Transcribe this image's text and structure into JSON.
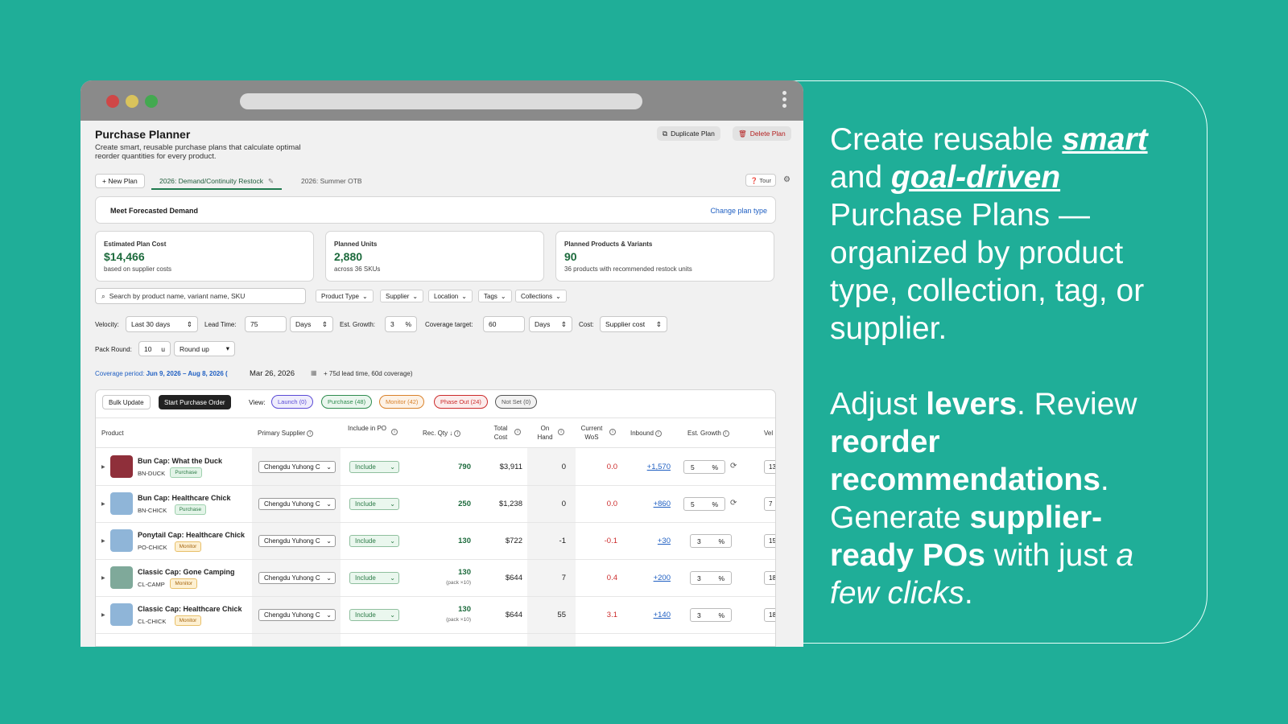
{
  "callout": {
    "p1": [
      "Create reusable ",
      "smart",
      " and ",
      "goal-driven",
      " Purchase Plans — organized by product type, collection, tag, or supplier."
    ],
    "p2": [
      "Adjust ",
      "levers",
      ". Review ",
      "reorder recommendations",
      ". Generate ",
      "supplier-ready POs",
      " with just ",
      "a few clicks",
      "."
    ]
  },
  "header": {
    "title": "Purchase Planner",
    "subtitle": "Create smart, reusable purchase plans that calculate optimal reorder quantities for every product.",
    "duplicate_label": "Duplicate Plan",
    "delete_label": "Delete Plan"
  },
  "tabs": {
    "new_label": "+ New Plan",
    "active": "2026: Demand/Continuity Restock",
    "inactive": "2026: Summer OTB",
    "tour": "Tour"
  },
  "plan_type": {
    "label": "Meet Forecasted Demand",
    "change_link": "Change plan type"
  },
  "stats": [
    {
      "label": "Estimated Plan Cost",
      "value": "$14,466",
      "sub": "based on supplier costs"
    },
    {
      "label": "Planned Units",
      "value": "2,880",
      "sub": "across 36 SKUs"
    },
    {
      "label": "Planned Products & Variants",
      "value": "90",
      "sub": "36 products with recommended restock units"
    }
  ],
  "search": {
    "placeholder": "Search by product name, variant name, SKU"
  },
  "filters": [
    "Product Type",
    "Supplier",
    "Location",
    "Tags",
    "Collections"
  ],
  "controls": {
    "velocity_label": "Velocity:",
    "velocity_value": "Last 30 days",
    "lead_label": "Lead Time:",
    "lead_value": "75",
    "lead_unit": "Days",
    "growth_label": "Est. Growth:",
    "growth_value": "3",
    "growth_unit": "%",
    "coverage_label": "Coverage target:",
    "coverage_value": "60",
    "coverage_unit": "Days",
    "cost_label": "Cost:",
    "cost_value": "Supplier cost",
    "pack_label": "Pack Round:",
    "pack_value": "10",
    "pack_unit": "u",
    "round_value": "Round up"
  },
  "coverage": {
    "prefix": "Coverage period: ",
    "range": "Jun 9, 2026 – Aug 8, 2026 (",
    "date": "Mar 26, 2026",
    "note": "+ 75d lead time, 60d coverage)"
  },
  "table_toolbar": {
    "bulk_label": "Bulk Update",
    "start_label": "Start Purchase Order",
    "view_label": "View:",
    "pills": [
      {
        "label": "Launch (0)",
        "color": "#5b4bd6"
      },
      {
        "label": "Purchase (48)",
        "color": "#2f8c4f"
      },
      {
        "label": "Monitor (42)",
        "color": "#d9822b"
      },
      {
        "label": "Phase Out (24)",
        "color": "#cc2b2b"
      },
      {
        "label": "Not Set (0)",
        "color": "#555555"
      }
    ]
  },
  "columns": [
    "Product",
    "Primary Supplier",
    "Include in PO",
    "Rec. Qty",
    "Total Cost",
    "On Hand",
    "Current WoS",
    "Inbound",
    "Est. Growth",
    "Vel"
  ],
  "rows": [
    {
      "name": "Bun Cap: What the Duck",
      "sku": "BN-DUCK",
      "badge": "Purchase",
      "supplier": "Chengdu Yuhong C",
      "include": "Include",
      "qty": "790",
      "pack": "",
      "cost": "$3,911",
      "on_hand": "0",
      "wos": "0.0",
      "inbound": "+1,570",
      "growth": "5",
      "vel": "13",
      "thumb": "#8f2f3a"
    },
    {
      "name": "Bun Cap: Healthcare Chick",
      "sku": "BN-CHICK",
      "badge": "Purchase",
      "supplier": "Chengdu Yuhong C",
      "include": "Include",
      "qty": "250",
      "pack": "",
      "cost": "$1,238",
      "on_hand": "0",
      "wos": "0.0",
      "inbound": "+860",
      "growth": "5",
      "vel": "7",
      "thumb": "#8fb5d8"
    },
    {
      "name": "Ponytail Cap: Healthcare Chick",
      "sku": "PO-CHICK",
      "badge": "Monitor",
      "supplier": "Chengdu Yuhong C",
      "include": "Include",
      "qty": "130",
      "pack": "",
      "cost": "$722",
      "on_hand": "-1",
      "wos": "-0.1",
      "inbound": "+30",
      "growth": "3",
      "vel": "15",
      "thumb": "#8fb5d8"
    },
    {
      "name": "Classic Cap: Gone Camping",
      "sku": "CL-CAMP",
      "badge": "Monitor",
      "supplier": "Chengdu Yuhong C",
      "include": "Include",
      "qty": "130",
      "pack": "(pack ×10)",
      "cost": "$644",
      "on_hand": "7",
      "wos": "0.4",
      "inbound": "+200",
      "growth": "3",
      "vel": "18",
      "thumb": "#7fa99a"
    },
    {
      "name": "Classic Cap: Healthcare Chick",
      "sku": "CL-CHICK",
      "badge": "Monitor",
      "supplier": "Chengdu Yuhong C",
      "include": "Include",
      "qty": "130",
      "pack": "(pack ×10)",
      "cost": "$644",
      "on_hand": "55",
      "wos": "3.1",
      "inbound": "+140",
      "growth": "3",
      "vel": "18",
      "thumb": "#8fb5d8"
    }
  ]
}
